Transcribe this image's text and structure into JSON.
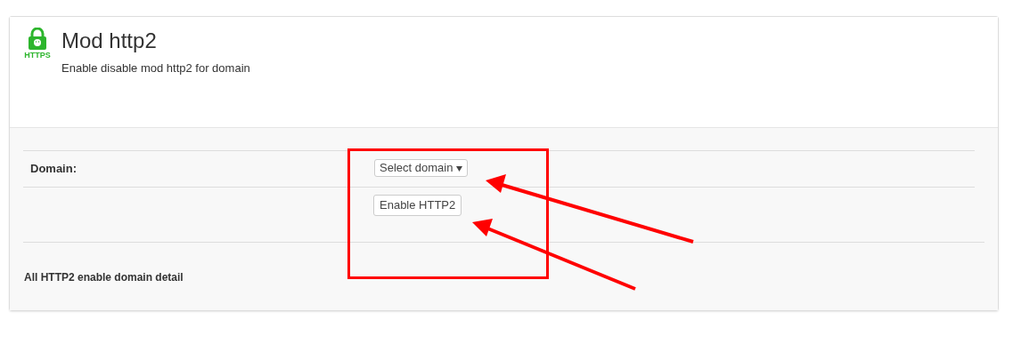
{
  "header": {
    "icon_text": "HTTPS",
    "title": "Mod http2",
    "subtitle": "Enable disable mod http2 for domain"
  },
  "form": {
    "label": "Domain:",
    "select": {
      "value": "Select domain"
    },
    "button": "Enable HTTP2"
  },
  "section_title": "All HTTP2 enable domain detail"
}
